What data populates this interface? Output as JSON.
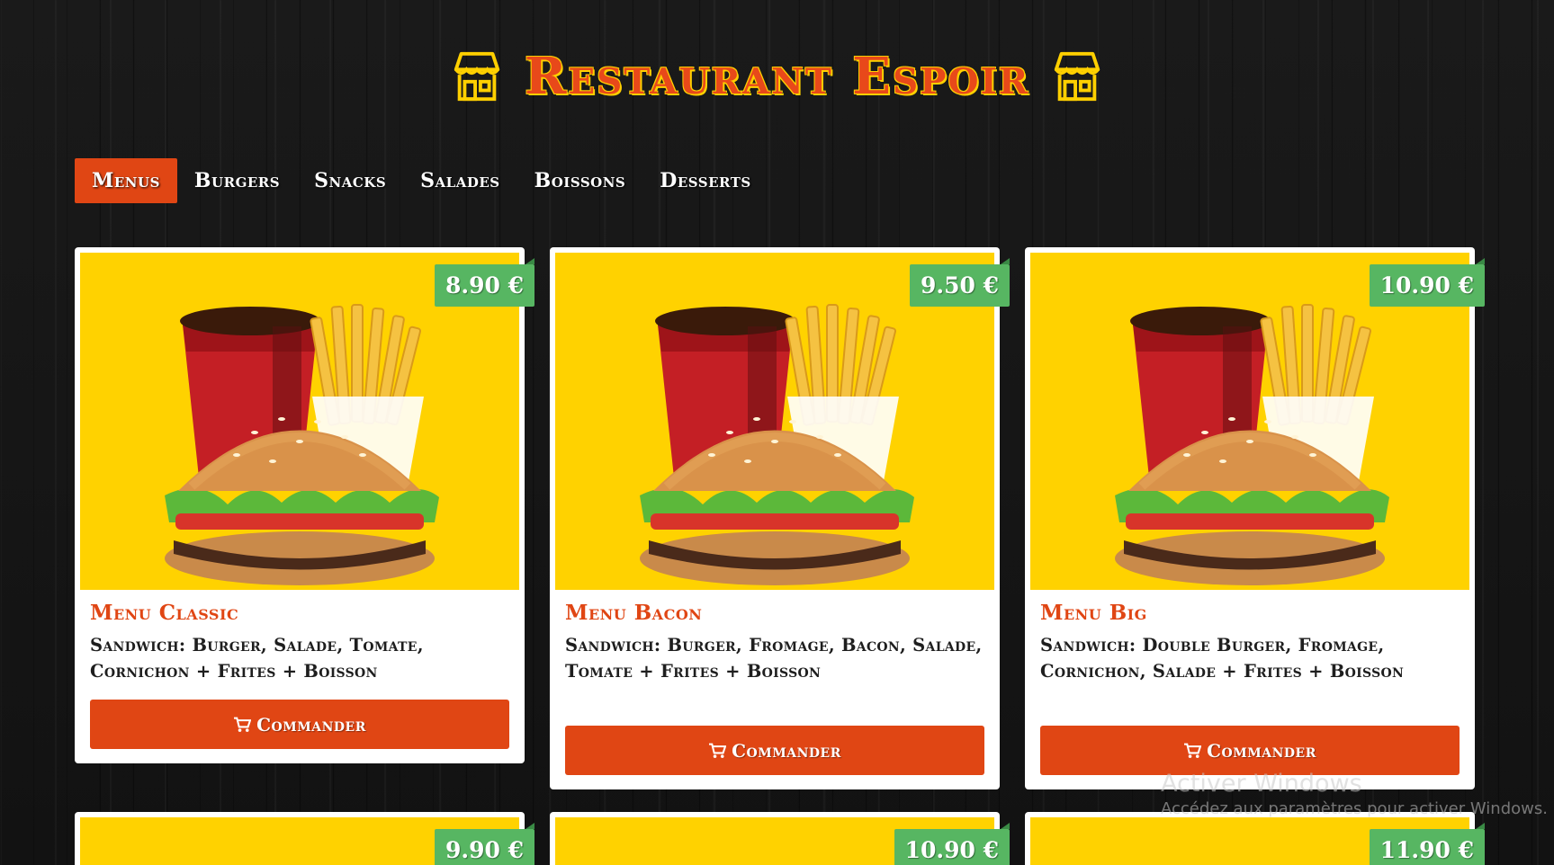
{
  "header": {
    "title": "Restaurant Espoir",
    "icon": "shop-icon"
  },
  "tabs": [
    {
      "label": "Menus",
      "active": true
    },
    {
      "label": "Burgers",
      "active": false
    },
    {
      "label": "Snacks",
      "active": false
    },
    {
      "label": "Salades",
      "active": false
    },
    {
      "label": "Boissons",
      "active": false
    },
    {
      "label": "Desserts",
      "active": false
    }
  ],
  "cards": [
    {
      "price": "8.90 €",
      "title": "Menu Classic",
      "description": "Sandwich: Burger, Salade, Tomate, Cornichon + Frites + Boisson",
      "button": "Commander",
      "image": "menu-classic-burger-fries-drink"
    },
    {
      "price": "9.50 €",
      "title": "Menu Bacon",
      "description": "Sandwich: Burger, Fromage, Bacon, Salade, Tomate + Frites + Boisson",
      "button": "Commander",
      "image": "menu-bacon-burger-fries-drink"
    },
    {
      "price": "10.90 €",
      "title": "Menu Big",
      "description": "Sandwich: Double Burger, Fromage, Cornichon, Salade + Frites + Boisson",
      "button": "Commander",
      "image": "menu-big-burger-fries-drink"
    },
    {
      "price": "9.90 €"
    },
    {
      "price": "10.90 €"
    },
    {
      "price": "11.90 €"
    }
  ],
  "colors": {
    "accent": "#e04614",
    "price_badge": "#57b662",
    "image_bg": "#ffd200",
    "title_outline": "#ffd000"
  },
  "watermark": {
    "title": "Activer Windows",
    "subtitle": "Accédez aux paramètres pour activer Windows."
  }
}
